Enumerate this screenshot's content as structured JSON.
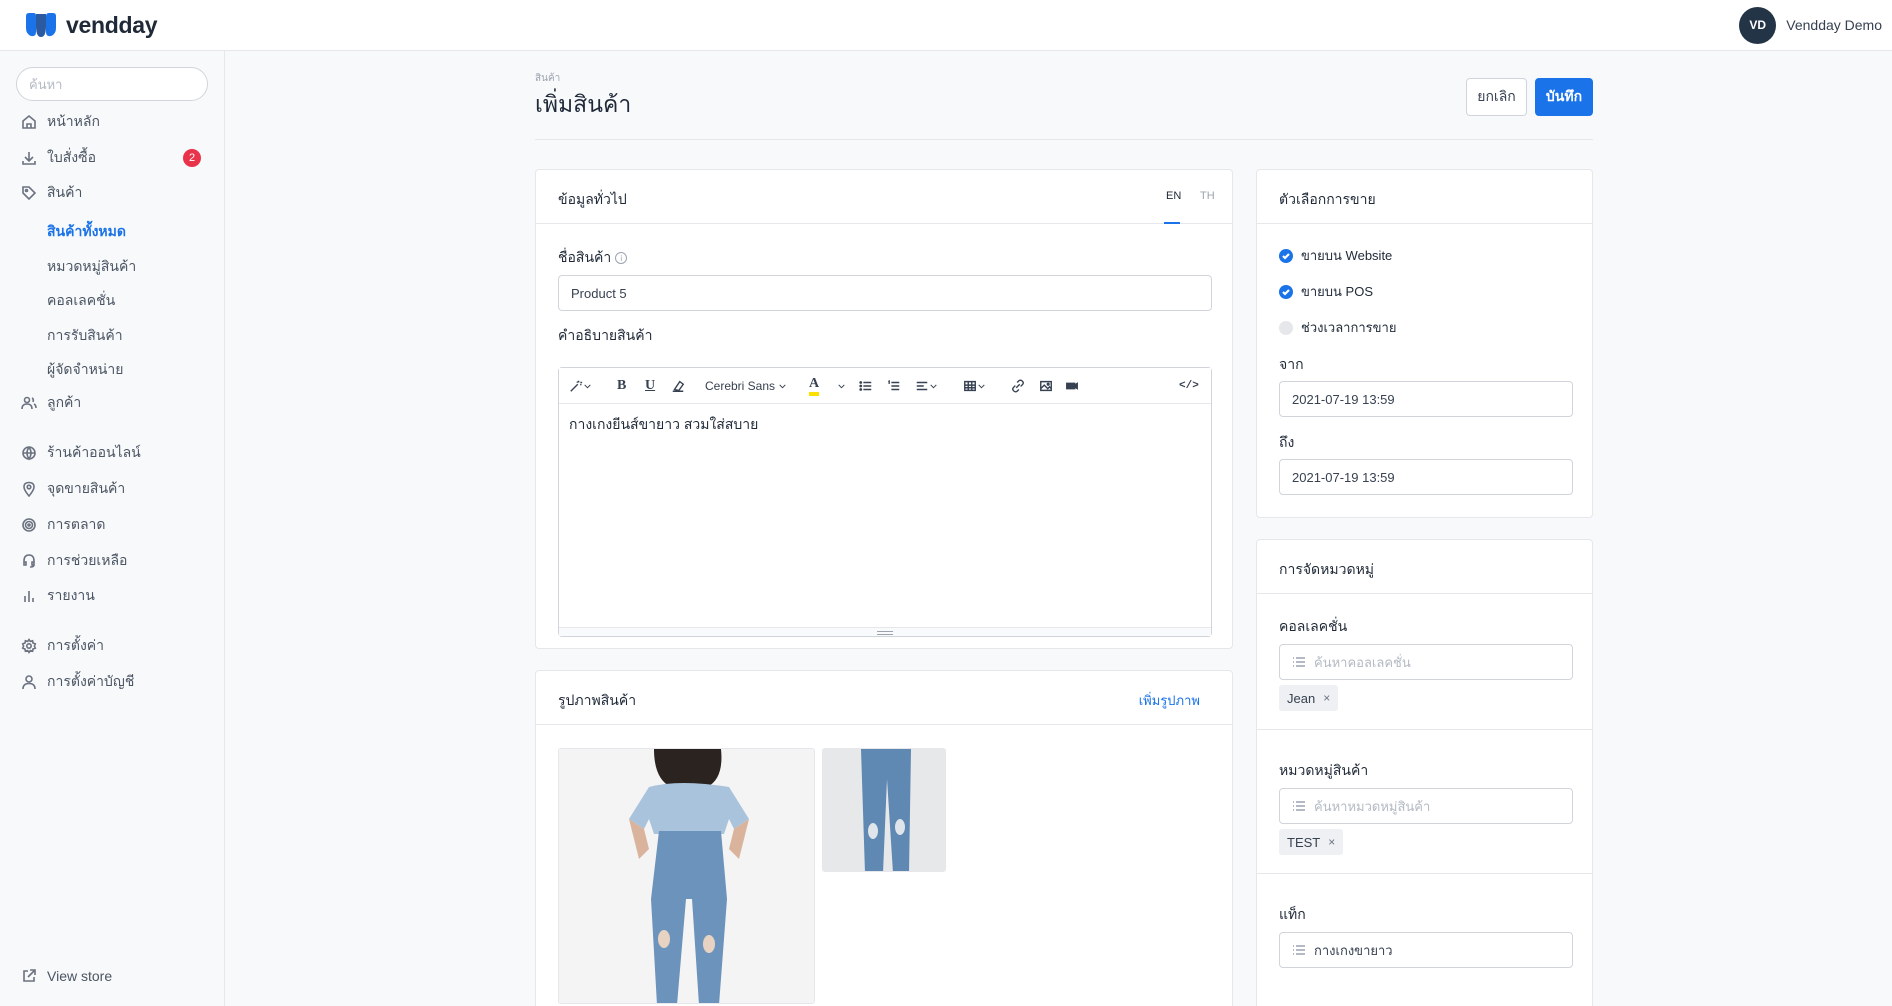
{
  "brand": {
    "name": "vendday",
    "accent": "#1a73e8"
  },
  "user": {
    "initials": "VD",
    "name": "Vendday Demo"
  },
  "sidebar": {
    "search_placeholder": "ค้นหา",
    "items": [
      {
        "label": "หน้าหลัก",
        "icon": "home-icon"
      },
      {
        "label": "ใบสั่งซื้อ",
        "icon": "download-icon",
        "badge": "2"
      },
      {
        "label": "สินค้า",
        "icon": "tag-icon"
      },
      {
        "label": "ลูกค้า",
        "icon": "users-icon"
      },
      {
        "label": "ร้านค้าออนไลน์",
        "icon": "globe-icon"
      },
      {
        "label": "จุดขายสินค้า",
        "icon": "map-pin-icon"
      },
      {
        "label": "การตลาด",
        "icon": "target-icon"
      },
      {
        "label": "การช่วยเหลือ",
        "icon": "headset-icon"
      },
      {
        "label": "รายงาน",
        "icon": "bar-chart-icon"
      },
      {
        "label": "การตั้งค่า",
        "icon": "gear-icon"
      },
      {
        "label": "การตั้งค่าบัญชี",
        "icon": "user-icon"
      }
    ],
    "product_subitems": [
      "สินค้าทั้งหมด",
      "หมวดหมู่สินค้า",
      "คอลเลคชั่น",
      "การรับสินค้า",
      "ผู้จัดจำหน่าย"
    ],
    "view_store": "View store"
  },
  "page": {
    "breadcrumb": "สินค้า",
    "title": "เพิ่มสินค้า",
    "cancel_label": "ยกเลิก",
    "save_label": "บันทึก"
  },
  "general": {
    "title": "ข้อมูลทั่วไป",
    "lang_en": "EN",
    "lang_th": "TH",
    "name_label": "ชื่อสินค้า",
    "name_value": "Product 5",
    "desc_label": "คำอธิบายสินค้า",
    "font_name": "Cerebri Sans",
    "desc_value": "กางเกงยีนส์ขายาว สวมใส่สบาย"
  },
  "images": {
    "title": "รูปภาพสินค้า",
    "add_label": "เพิ่มรูปภาพ"
  },
  "sales": {
    "title": "ตัวเลือกการขาย",
    "options": [
      {
        "label": "ขายบน Website",
        "checked": true
      },
      {
        "label": "ขายบน POS",
        "checked": true
      },
      {
        "label": "ช่วงเวลาการขาย",
        "checked": false
      }
    ],
    "from_label": "จาก",
    "from_value": "2021-07-19 13:59",
    "to_label": "ถึง",
    "to_value": "2021-07-19 13:59"
  },
  "categorize": {
    "title": "การจัดหมวดหมู่",
    "collection_label": "คอลเลคชั่น",
    "collection_placeholder": "ค้นหาคอลเลคชั่น",
    "collection_tag": "Jean",
    "category_label": "หมวดหมู่สินค้า",
    "category_placeholder": "ค้นหาหมวดหมู่สินค้า",
    "category_tag": "TEST",
    "tags_label": "แท็ก",
    "tags_value": "กางเกงขายาว",
    "remove_symbol": "×"
  }
}
